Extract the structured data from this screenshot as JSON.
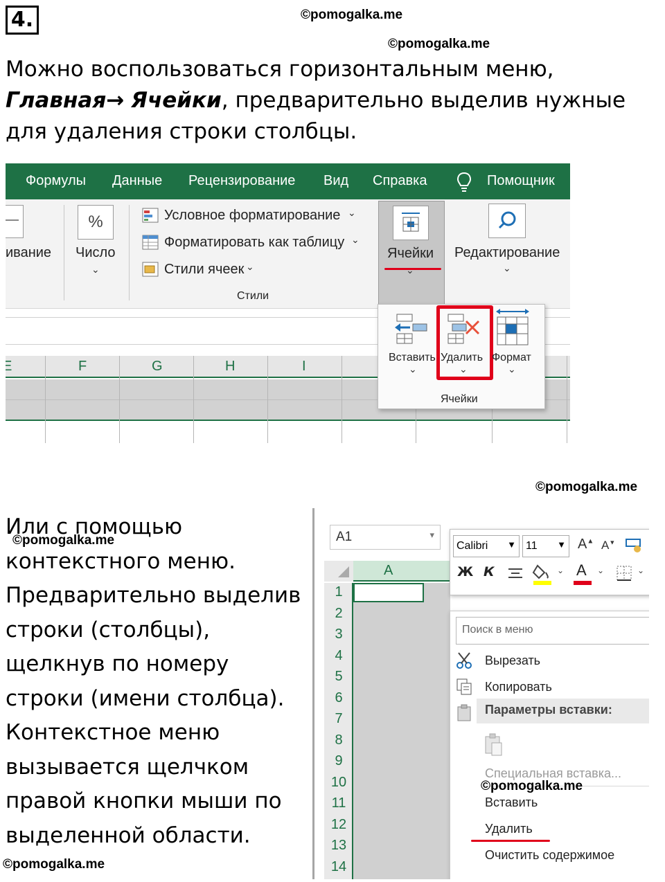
{
  "task_number": "4.",
  "watermarks": [
    "©pomogalka.me",
    "©pomogalka.me",
    "©pomogalka.me",
    "©pomogalka.me",
    "©pomogalka.me",
    "©pomogalka.me"
  ],
  "intro": {
    "part1": "Можно воспользоваться горизонтальным меню, ",
    "bold1": "Главная",
    "arrow": "→",
    "bold2": "Ячейки",
    "part2": ", предварительно выделив нужные для удаления строки столбцы."
  },
  "ribbon": {
    "tabs": [
      "Формулы",
      "Данные",
      "Рецензирование",
      "Вид",
      "Справка",
      "Помощник"
    ],
    "alignment_partial": "ивание",
    "number_label": "Число",
    "percent_glyph": "%",
    "styles_items": [
      "Условное форматирование",
      "Форматировать как таблицу",
      "Стили ячеек"
    ],
    "styles_group": "Стили",
    "cells_label": "Ячейки",
    "editing_label": "Редактирование",
    "columns": [
      "E",
      "F",
      "G",
      "H",
      "I"
    ],
    "dropdown": {
      "insert": "Вставить",
      "delete": "Удалить",
      "format": "Формат",
      "group": "Ячейки"
    }
  },
  "side_text": "Или с помощью контекстного меню. Предварительно выделив строки (столбцы), щелкнув по номеру строки (имени столбца). Контекстное меню вызывается щелчком правой кнопки мыши по выделенной области.",
  "excel": {
    "namebox": "A1",
    "column": "A",
    "rows": [
      "1",
      "2",
      "3",
      "4",
      "5",
      "6",
      "7",
      "8",
      "9",
      "10",
      "11",
      "12",
      "13",
      "14"
    ],
    "font_name": "Calibri",
    "font_size": "11",
    "bold_glyph": "Ж",
    "italic_glyph": "К",
    "menu": {
      "search_placeholder": "Поиск в меню",
      "cut": "Вырезать",
      "copy": "Копировать",
      "paste_options": "Параметры вставки:",
      "paste_special": "Специальная вставка...",
      "insert": "Вставить",
      "delete": "Удалить",
      "clear": "Очистить содержимое"
    }
  },
  "colors": {
    "excel_green": "#1e7145",
    "highlight_red": "#e0001a",
    "grid_grey": "#d2d2d2"
  }
}
